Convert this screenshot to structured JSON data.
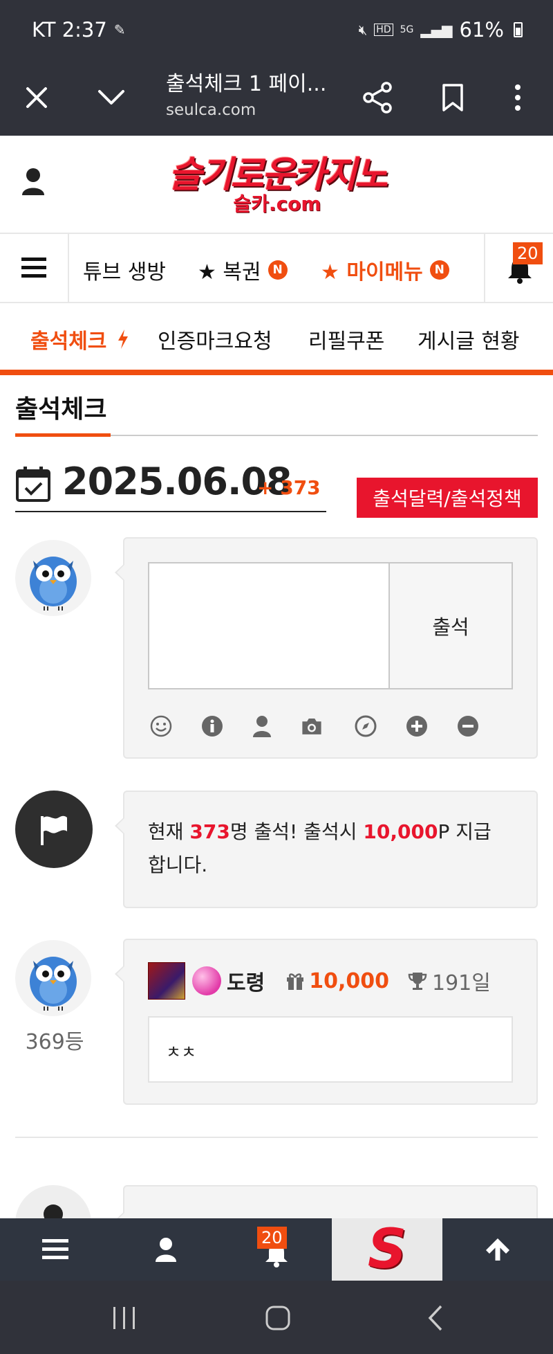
{
  "status_bar": {
    "carrier_time": "KT 2:37",
    "battery": "61%"
  },
  "browser": {
    "page_title": "출석체크 1 페이...",
    "url": "seulca.com"
  },
  "site": {
    "logo_main": "슬기로운카지노",
    "logo_sub": "슬카.com"
  },
  "main_nav": {
    "items": [
      {
        "label": "튜브 생방"
      },
      {
        "label": "★ 복권",
        "badge": "N"
      },
      {
        "label": "★ 마이메뉴",
        "badge": "N"
      }
    ],
    "notification_count": "20"
  },
  "sub_nav": {
    "items": [
      "출석체크",
      "인증마크요청",
      "리필쿠폰",
      "게시글 현황"
    ]
  },
  "section": {
    "title": "출석체크",
    "date": "2025.06.08",
    "date_increment": "+ 373",
    "policy_button": "출석달력/출석정책"
  },
  "checkin_form": {
    "submit_label": "출석"
  },
  "notice": {
    "prefix": "현재 ",
    "count": "373",
    "mid": "명 출석! 출석시 ",
    "points": "10,000",
    "suffix": "P 지급합니다."
  },
  "entries": [
    {
      "rank": "369등",
      "nickname": "도령",
      "points": "10,000",
      "days": "191일",
      "comment": "ㅊㅊ"
    }
  ],
  "bottom_bar": {
    "notification_count": "20",
    "logo_letter": "S"
  },
  "colors": {
    "accent": "#f04e10",
    "brand_red": "#e8152d",
    "dark": "#30323a"
  }
}
